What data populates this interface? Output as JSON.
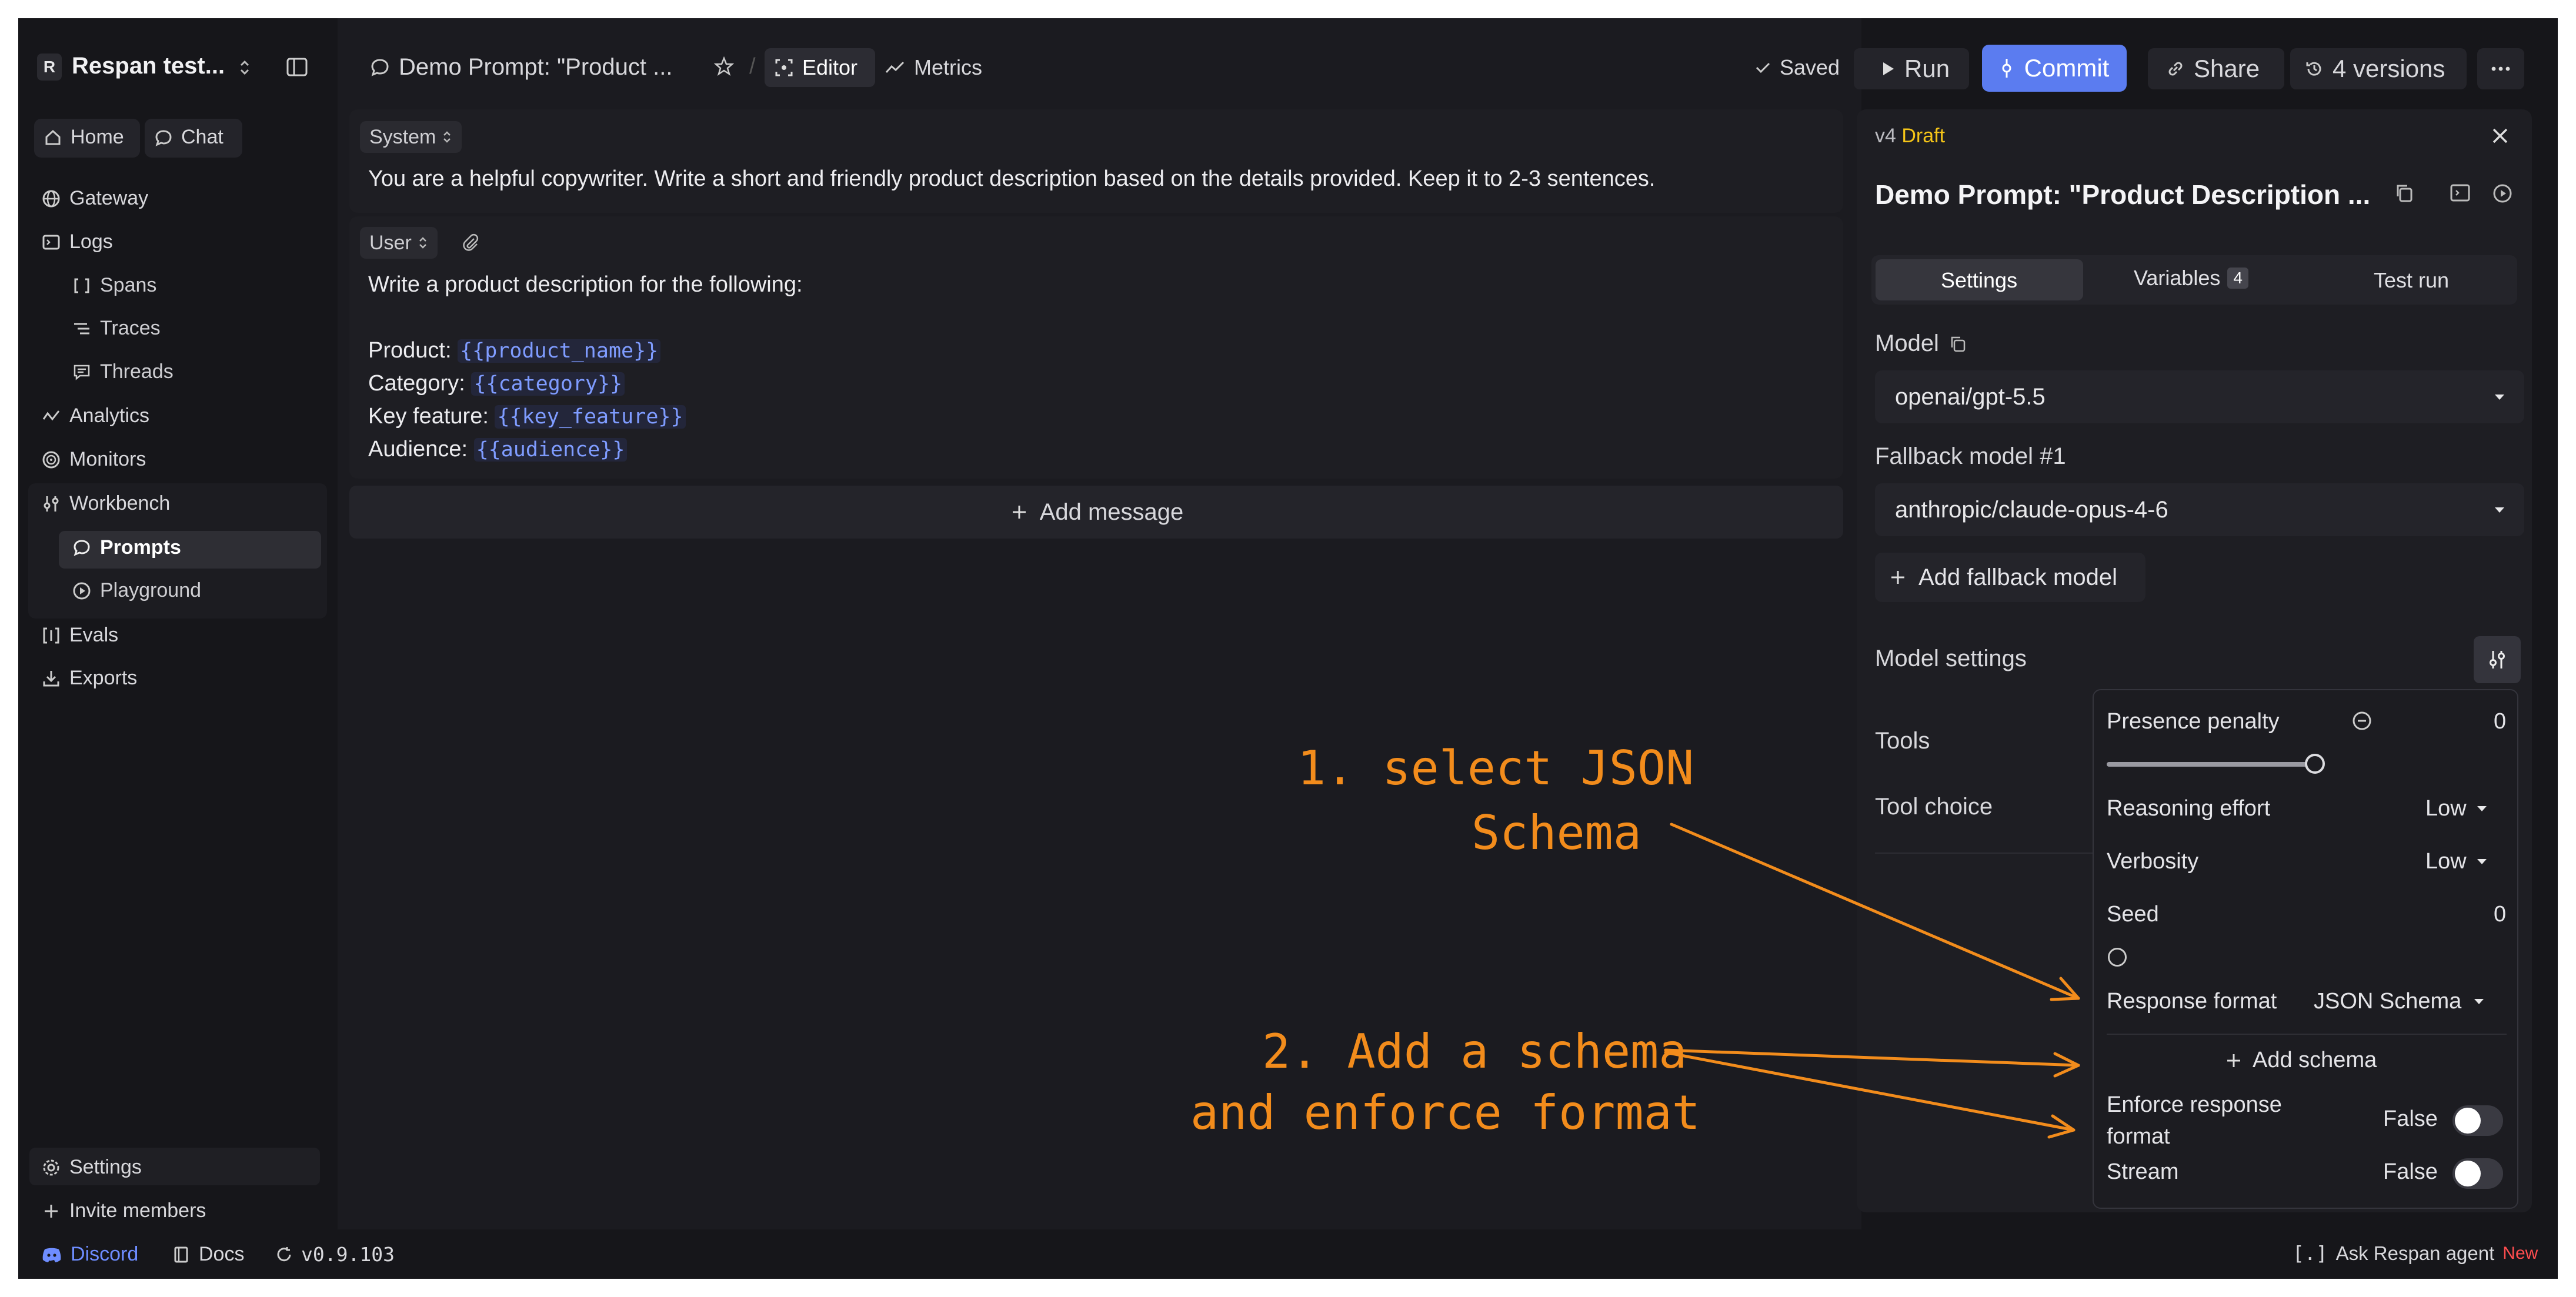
{
  "workspace": {
    "badge": "R",
    "name": "Respan test..."
  },
  "sidebar": {
    "home": "Home",
    "chat": "Chat",
    "gateway": "Gateway",
    "logs": "Logs",
    "spans": "Spans",
    "traces": "Traces",
    "threads": "Threads",
    "analytics": "Analytics",
    "monitors": "Monitors",
    "workbench": "Workbench",
    "prompts": "Prompts",
    "playground": "Playground",
    "evals": "Evals",
    "exports": "Exports",
    "settings": "Settings",
    "invite": "Invite members"
  },
  "footer": {
    "discord": "Discord",
    "docs": "Docs",
    "version": "v0.9.103",
    "agent": "Ask Respan agent",
    "agent_badge": "New"
  },
  "topbar": {
    "prompt_title": "Demo Prompt: \"Product ...",
    "editor": "Editor",
    "metrics": "Metrics",
    "saved": "Saved",
    "run": "Run",
    "commit": "Commit",
    "share": "Share",
    "versions": "4 versions"
  },
  "editor": {
    "system_role": "System",
    "system_text": "You are a helpful copywriter. Write a short and friendly product description based on the details provided. Keep it to 2-3 sentences.",
    "user_role": "User",
    "user_intro": "Write a product description for the following:",
    "fields": [
      {
        "label": "Product:",
        "var": "{{product_name}}"
      },
      {
        "label": "Category:",
        "var": "{{category}}"
      },
      {
        "label": "Key feature:",
        "var": "{{key_feature}}"
      },
      {
        "label": "Audience:",
        "var": "{{audience}}"
      }
    ],
    "add_message": "Add message"
  },
  "panel": {
    "version": "v4",
    "status": "Draft",
    "title": "Demo Prompt: \"Product Description ...",
    "tabs": {
      "settings": "Settings",
      "variables": "Variables",
      "variables_count": "4",
      "test_run": "Test run"
    },
    "model_label": "Model",
    "model_value": "openai/gpt-5.5",
    "fallback_label": "Fallback model #1",
    "fallback_value": "anthropic/claude-opus-4-6",
    "add_fallback": "Add fallback model",
    "model_settings": "Model settings",
    "tools": "Tools",
    "tool_choice": "Tool choice"
  },
  "model_settings": {
    "presence_penalty_label": "Presence penalty",
    "presence_penalty_value": "0",
    "presence_penalty_level": 1.0,
    "reasoning_effort_label": "Reasoning effort",
    "reasoning_effort_value": "Low",
    "verbosity_label": "Verbosity",
    "verbosity_value": "Low",
    "seed_label": "Seed",
    "seed_value": "0",
    "response_format_label": "Response format",
    "response_format_value": "JSON Schema",
    "add_schema": "Add schema",
    "enforce_label_1": "Enforce response",
    "enforce_label_2": "format",
    "enforce_value": "False",
    "stream_label": "Stream",
    "stream_value": "False"
  },
  "annotations": {
    "step1_line1": "1. select JSON",
    "step1_line2": "Schema",
    "step2_line1": "2. Add a schema",
    "step2_line2": "and enforce format"
  },
  "colors": {
    "accent": "#5b7cf0",
    "draft": "#f5c518",
    "annotation": "#f28c1c",
    "variable": "#7f9cff",
    "new_badge": "#ff4d4f"
  }
}
